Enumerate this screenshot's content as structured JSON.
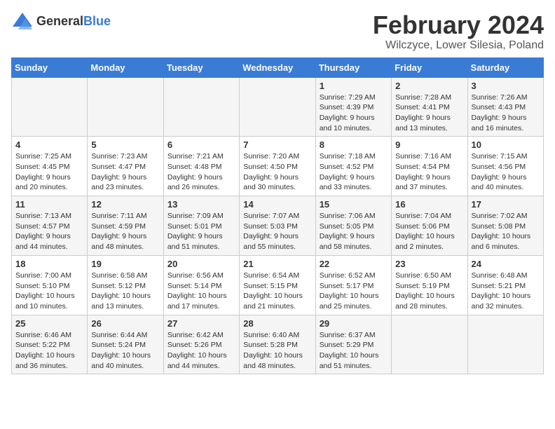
{
  "logo": {
    "text_general": "General",
    "text_blue": "Blue"
  },
  "header": {
    "month": "February 2024",
    "location": "Wilczyce, Lower Silesia, Poland"
  },
  "weekdays": [
    "Sunday",
    "Monday",
    "Tuesday",
    "Wednesday",
    "Thursday",
    "Friday",
    "Saturday"
  ],
  "weeks": [
    [
      {
        "day": "",
        "info": ""
      },
      {
        "day": "",
        "info": ""
      },
      {
        "day": "",
        "info": ""
      },
      {
        "day": "",
        "info": ""
      },
      {
        "day": "1",
        "info": "Sunrise: 7:29 AM\nSunset: 4:39 PM\nDaylight: 9 hours\nand 10 minutes."
      },
      {
        "day": "2",
        "info": "Sunrise: 7:28 AM\nSunset: 4:41 PM\nDaylight: 9 hours\nand 13 minutes."
      },
      {
        "day": "3",
        "info": "Sunrise: 7:26 AM\nSunset: 4:43 PM\nDaylight: 9 hours\nand 16 minutes."
      }
    ],
    [
      {
        "day": "4",
        "info": "Sunrise: 7:25 AM\nSunset: 4:45 PM\nDaylight: 9 hours\nand 20 minutes."
      },
      {
        "day": "5",
        "info": "Sunrise: 7:23 AM\nSunset: 4:47 PM\nDaylight: 9 hours\nand 23 minutes."
      },
      {
        "day": "6",
        "info": "Sunrise: 7:21 AM\nSunset: 4:48 PM\nDaylight: 9 hours\nand 26 minutes."
      },
      {
        "day": "7",
        "info": "Sunrise: 7:20 AM\nSunset: 4:50 PM\nDaylight: 9 hours\nand 30 minutes."
      },
      {
        "day": "8",
        "info": "Sunrise: 7:18 AM\nSunset: 4:52 PM\nDaylight: 9 hours\nand 33 minutes."
      },
      {
        "day": "9",
        "info": "Sunrise: 7:16 AM\nSunset: 4:54 PM\nDaylight: 9 hours\nand 37 minutes."
      },
      {
        "day": "10",
        "info": "Sunrise: 7:15 AM\nSunset: 4:56 PM\nDaylight: 9 hours\nand 40 minutes."
      }
    ],
    [
      {
        "day": "11",
        "info": "Sunrise: 7:13 AM\nSunset: 4:57 PM\nDaylight: 9 hours\nand 44 minutes."
      },
      {
        "day": "12",
        "info": "Sunrise: 7:11 AM\nSunset: 4:59 PM\nDaylight: 9 hours\nand 48 minutes."
      },
      {
        "day": "13",
        "info": "Sunrise: 7:09 AM\nSunset: 5:01 PM\nDaylight: 9 hours\nand 51 minutes."
      },
      {
        "day": "14",
        "info": "Sunrise: 7:07 AM\nSunset: 5:03 PM\nDaylight: 9 hours\nand 55 minutes."
      },
      {
        "day": "15",
        "info": "Sunrise: 7:06 AM\nSunset: 5:05 PM\nDaylight: 9 hours\nand 58 minutes."
      },
      {
        "day": "16",
        "info": "Sunrise: 7:04 AM\nSunset: 5:06 PM\nDaylight: 10 hours\nand 2 minutes."
      },
      {
        "day": "17",
        "info": "Sunrise: 7:02 AM\nSunset: 5:08 PM\nDaylight: 10 hours\nand 6 minutes."
      }
    ],
    [
      {
        "day": "18",
        "info": "Sunrise: 7:00 AM\nSunset: 5:10 PM\nDaylight: 10 hours\nand 10 minutes."
      },
      {
        "day": "19",
        "info": "Sunrise: 6:58 AM\nSunset: 5:12 PM\nDaylight: 10 hours\nand 13 minutes."
      },
      {
        "day": "20",
        "info": "Sunrise: 6:56 AM\nSunset: 5:14 PM\nDaylight: 10 hours\nand 17 minutes."
      },
      {
        "day": "21",
        "info": "Sunrise: 6:54 AM\nSunset: 5:15 PM\nDaylight: 10 hours\nand 21 minutes."
      },
      {
        "day": "22",
        "info": "Sunrise: 6:52 AM\nSunset: 5:17 PM\nDaylight: 10 hours\nand 25 minutes."
      },
      {
        "day": "23",
        "info": "Sunrise: 6:50 AM\nSunset: 5:19 PM\nDaylight: 10 hours\nand 28 minutes."
      },
      {
        "day": "24",
        "info": "Sunrise: 6:48 AM\nSunset: 5:21 PM\nDaylight: 10 hours\nand 32 minutes."
      }
    ],
    [
      {
        "day": "25",
        "info": "Sunrise: 6:46 AM\nSunset: 5:22 PM\nDaylight: 10 hours\nand 36 minutes."
      },
      {
        "day": "26",
        "info": "Sunrise: 6:44 AM\nSunset: 5:24 PM\nDaylight: 10 hours\nand 40 minutes."
      },
      {
        "day": "27",
        "info": "Sunrise: 6:42 AM\nSunset: 5:26 PM\nDaylight: 10 hours\nand 44 minutes."
      },
      {
        "day": "28",
        "info": "Sunrise: 6:40 AM\nSunset: 5:28 PM\nDaylight: 10 hours\nand 48 minutes."
      },
      {
        "day": "29",
        "info": "Sunrise: 6:37 AM\nSunset: 5:29 PM\nDaylight: 10 hours\nand 51 minutes."
      },
      {
        "day": "",
        "info": ""
      },
      {
        "day": "",
        "info": ""
      }
    ]
  ]
}
